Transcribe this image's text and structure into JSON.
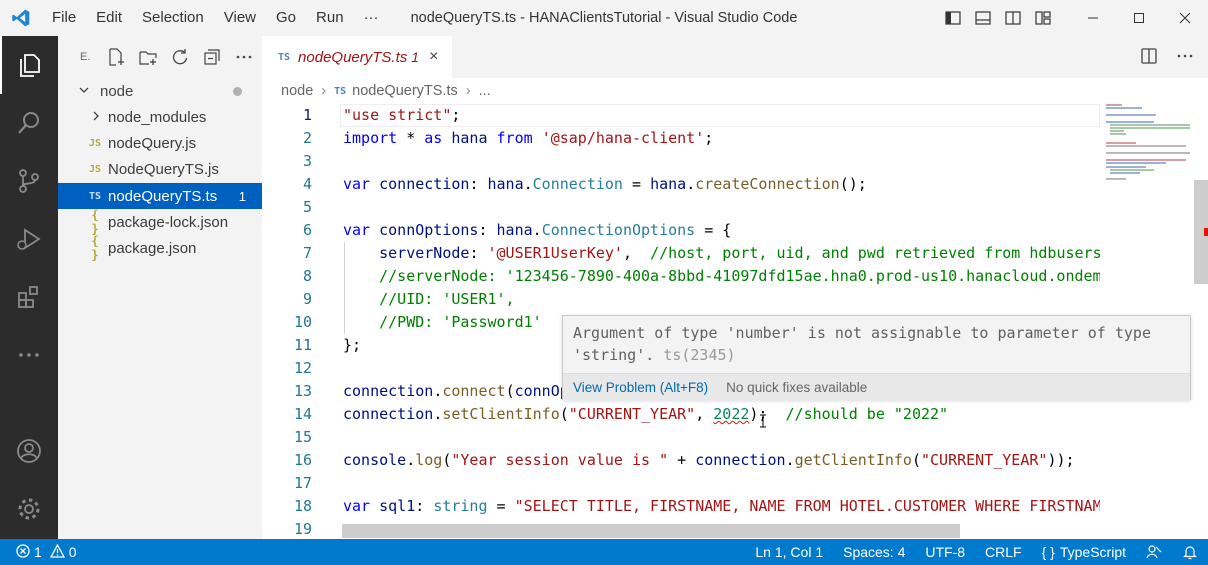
{
  "titlebar": {
    "menu": [
      "File",
      "Edit",
      "Selection",
      "View",
      "Go",
      "Run",
      "···"
    ],
    "title": "nodeQueryTS.ts - HANAClientsTutorial - Visual Studio Code"
  },
  "sidebar": {
    "header_letter": "E.",
    "root_folder": "node",
    "items": [
      {
        "label": "node_modules",
        "kind": "folder"
      },
      {
        "label": "nodeQuery.js",
        "kind": "js",
        "icon": "JS"
      },
      {
        "label": "NodeQueryTS.js",
        "kind": "js",
        "icon": "JS"
      },
      {
        "label": "nodeQueryTS.ts",
        "kind": "ts",
        "icon": "TS",
        "badge": "1",
        "selected": true
      },
      {
        "label": "package-lock.json",
        "kind": "json",
        "icon": "{ }"
      },
      {
        "label": "package.json",
        "kind": "json",
        "icon": "{ }"
      }
    ]
  },
  "tab": {
    "icon": "TS",
    "name": "nodeQueryTS.ts",
    "problems": "1",
    "close": "×"
  },
  "breadcrumb": {
    "folder": "node",
    "icon": "TS",
    "file": "nodeQueryTS.ts",
    "ellipsis": "..."
  },
  "editor": {
    "line_numbers": [
      "1",
      "2",
      "3",
      "4",
      "5",
      "6",
      "7",
      "8",
      "9",
      "10",
      "11",
      "12",
      "13",
      "14",
      "15",
      "16",
      "17",
      "18",
      "19"
    ]
  },
  "hover": {
    "message": "Argument of type 'number' is not assignable to parameter of type 'string'.",
    "code": "ts(2345)",
    "view_problem": "View Problem (Alt+F8)",
    "no_fix": "No quick fixes available"
  },
  "statusbar": {
    "errors": "1",
    "warnings": "0",
    "position": "Ln 1, Col 1",
    "spaces": "Spaces: 4",
    "encoding": "UTF-8",
    "eol": "CRLF",
    "language": "TypeScript"
  },
  "colors": {
    "accent": "#007acc",
    "activity_bar": "#2c2c2c",
    "selection": "#0060c0",
    "error": "#e51400"
  }
}
